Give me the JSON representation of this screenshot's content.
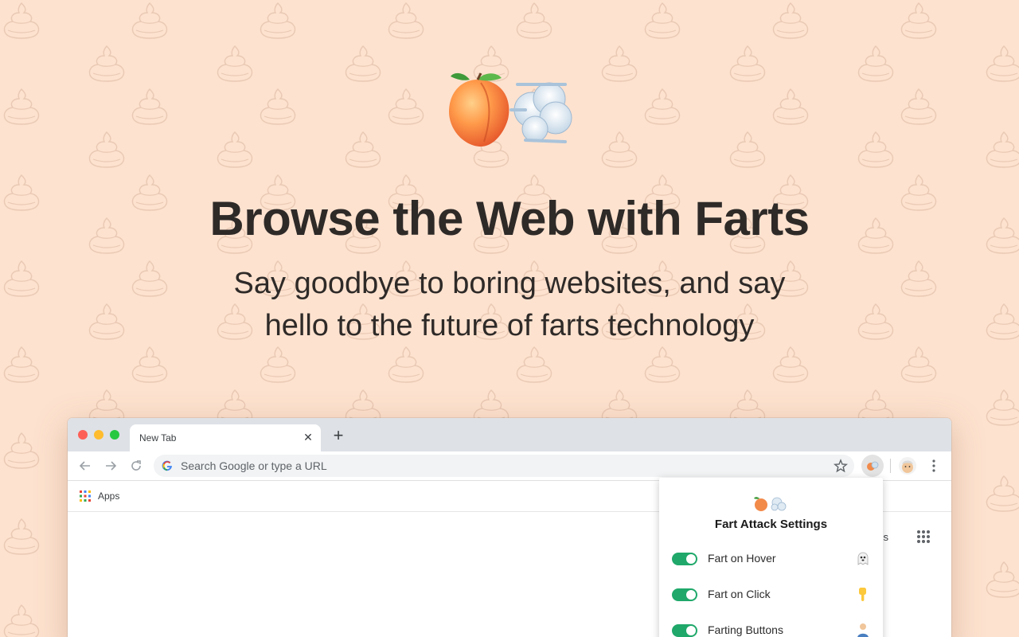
{
  "colors": {
    "background": "#fde2cf",
    "pattern": "#e9c9b4",
    "toggle_on": "#1fa86a",
    "tabstrip": "#dee1e6"
  },
  "hero": {
    "icon": "peach-and-wind-emoji-icon",
    "headline": "Browse the Web with Farts",
    "subline_1": "Say goodbye to boring websites, and say",
    "subline_2": "hello to the future of farts technology"
  },
  "browser": {
    "tab": {
      "title": "New Tab",
      "close_icon": "close-icon"
    },
    "new_tab_icon": "plus-icon",
    "toolbar": {
      "back_icon": "back-arrow-icon",
      "forward_icon": "forward-arrow-icon",
      "reload_icon": "reload-icon",
      "omnibox_placeholder": "Search Google or type a URL",
      "bookmark_icon": "star-icon",
      "extension_icon": "fart-attack-extension-icon",
      "avatar_icon": "profile-avatar-icon",
      "menu_icon": "kebab-menu-icon"
    },
    "bookmarks_bar": {
      "apps_label": "Apps",
      "apps_icon": "apps-grid-icon"
    },
    "page": {
      "partial_link": "ges",
      "google_apps_icon": "google-apps-grid-icon"
    }
  },
  "popup": {
    "icon": "peach-and-wind-emoji-icon",
    "title": "Fart Attack Settings",
    "settings": [
      {
        "label": "Fart on Hover",
        "enabled": true,
        "emoji": "ghost-emoji-icon"
      },
      {
        "label": "Fart on Click",
        "enabled": true,
        "emoji": "pointing-down-emoji-icon"
      },
      {
        "label": "Farting Buttons",
        "enabled": true,
        "emoji": "person-emoji-icon"
      }
    ]
  }
}
